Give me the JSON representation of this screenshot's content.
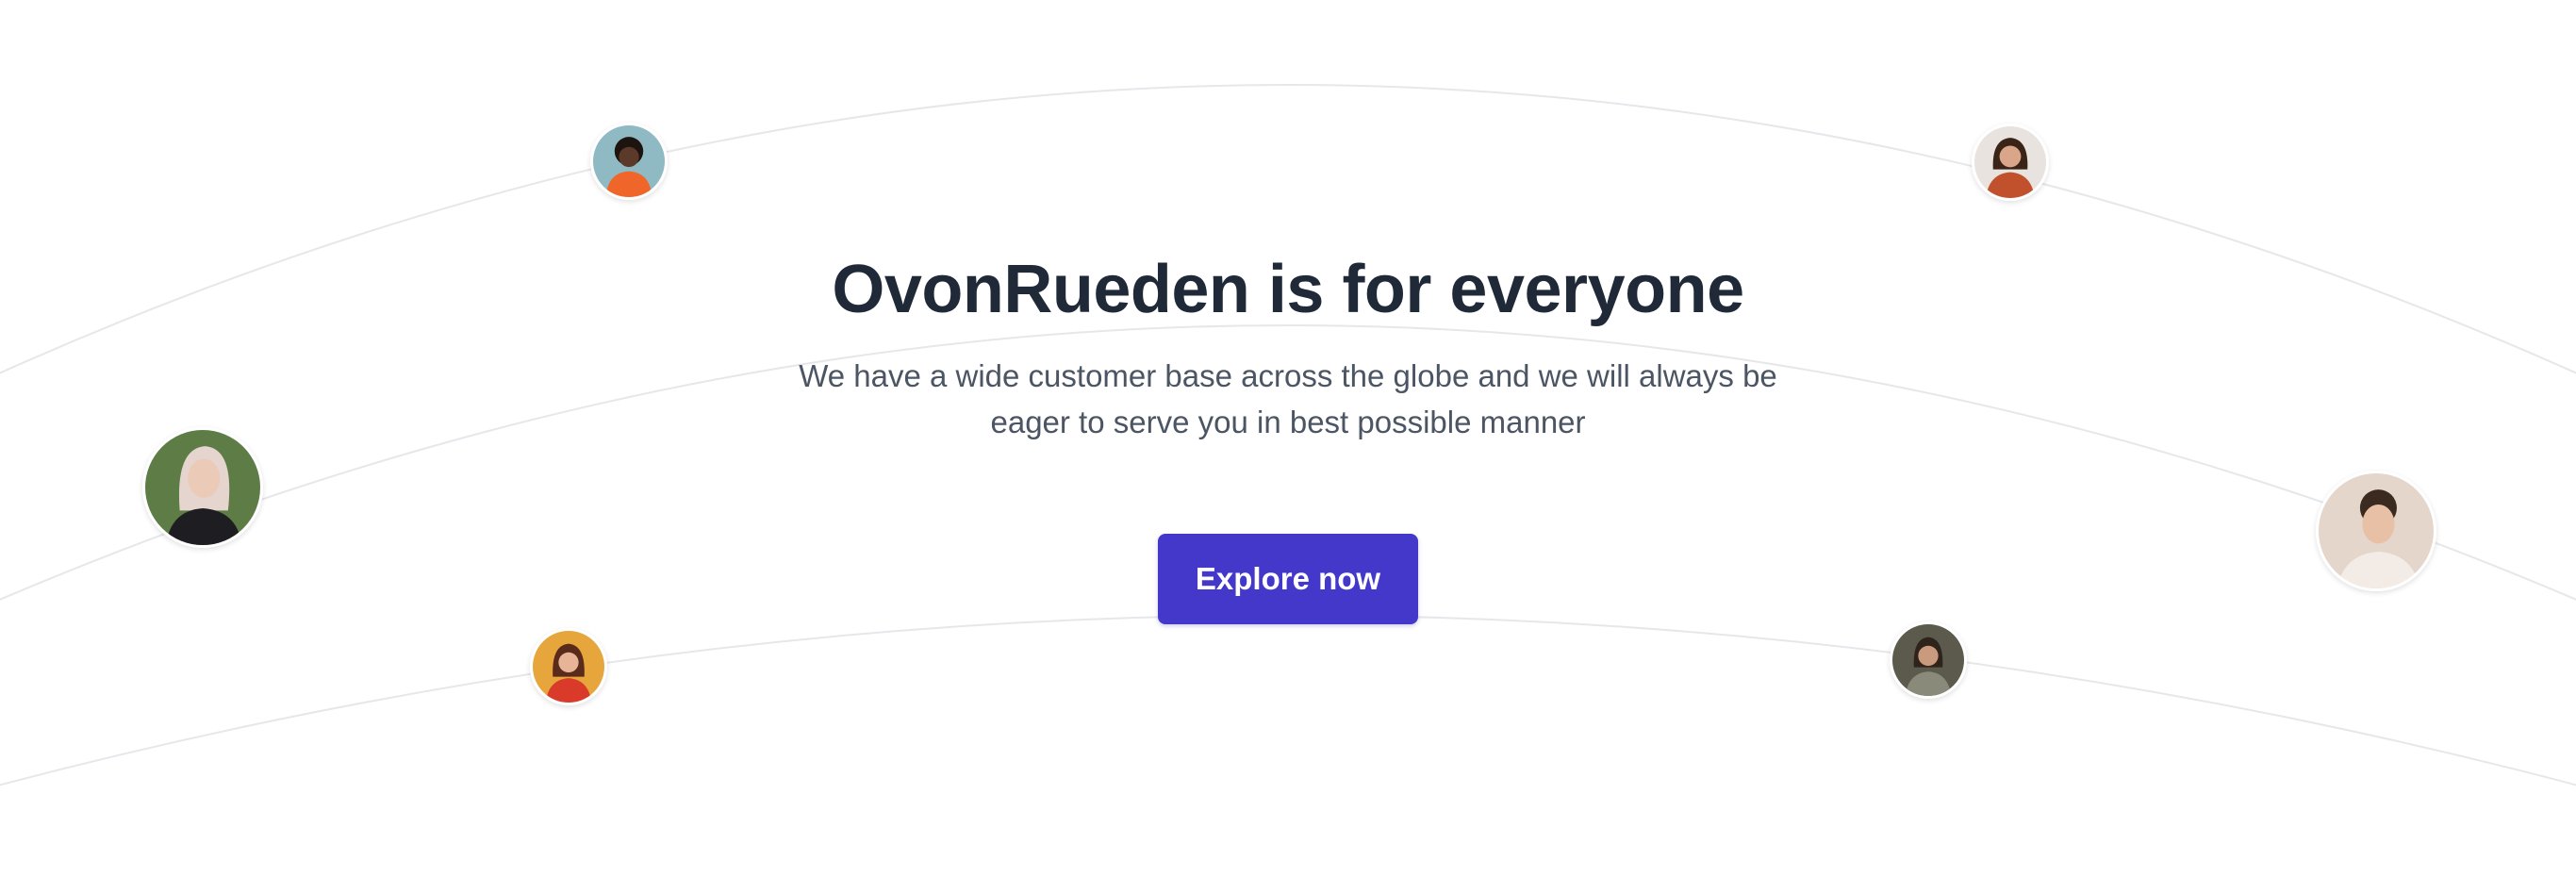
{
  "hero": {
    "title": "OvonRueden is for everyone",
    "subtitle": "We have a wide customer base across the globe and we will always be eager to serve you in best possible manner",
    "cta_label": "Explore now"
  },
  "avatars": [
    {
      "name": "customer-avatar-1",
      "bg": "#8fb9c3",
      "skin": "#5b3a29",
      "hair": "#1d1410",
      "shirt": "#f0652a"
    },
    {
      "name": "customer-avatar-2",
      "bg": "#e8e3df",
      "skin": "#d9a68a",
      "hair": "#3a2418",
      "shirt": "#c0512c"
    },
    {
      "name": "customer-avatar-3",
      "bg": "#5d7c46",
      "skin": "#eccab8",
      "hair": "#e6d4cf",
      "shirt": "#1e1e22"
    },
    {
      "name": "customer-avatar-4",
      "bg": "#e5d6cc",
      "skin": "#e7c0a5",
      "hair": "#3b2a1f",
      "shirt": "#f3ece6"
    },
    {
      "name": "customer-avatar-5",
      "bg": "#e6a63b",
      "skin": "#e7b497",
      "hair": "#5a2b1b",
      "shirt": "#d93a2a"
    },
    {
      "name": "customer-avatar-6",
      "bg": "#5b5a4d",
      "skin": "#c99a7e",
      "hair": "#2f241c",
      "shirt": "#8a8a7a"
    }
  ],
  "colors": {
    "title": "#1f2937",
    "subtitle": "#4b5563",
    "button": "#4338ca",
    "arc": "#e6e7ea"
  }
}
